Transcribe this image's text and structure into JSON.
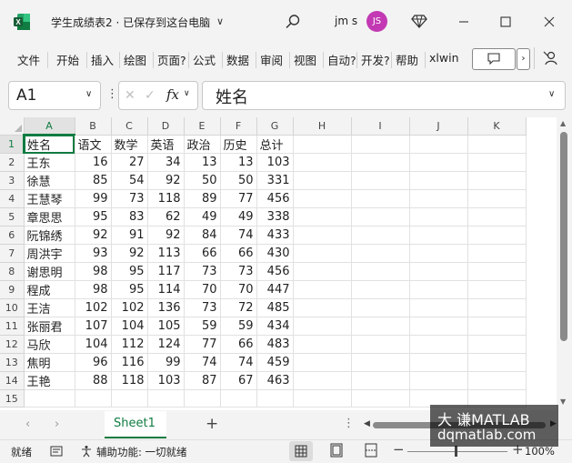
{
  "titlebar": {
    "doc_title": "学生成绩表2 · 已保存到这台电脑",
    "user_name": "jm s",
    "avatar_initials": "JS"
  },
  "ribbon": {
    "tabs": [
      "文件",
      "开始",
      "插入",
      "绘图",
      "页面?",
      "公式",
      "数据",
      "审阅",
      "视图",
      "自动?",
      "开发?",
      "帮助",
      "xlwin"
    ]
  },
  "formula_bar": {
    "name_box": "A1",
    "fx_label": "fx",
    "formula": "姓名"
  },
  "grid": {
    "columns": [
      "A",
      "B",
      "C",
      "D",
      "E",
      "F",
      "G",
      "H",
      "I",
      "J",
      "K"
    ],
    "selected_column": "A",
    "rows": [
      [
        "姓名",
        "语文",
        "数学",
        "英语",
        "政治",
        "历史",
        "总计"
      ],
      [
        "王东",
        "16",
        "27",
        "34",
        "13",
        "13",
        "103"
      ],
      [
        "徐慧",
        "85",
        "54",
        "92",
        "50",
        "50",
        "331"
      ],
      [
        "王慧琴",
        "99",
        "73",
        "118",
        "89",
        "77",
        "456"
      ],
      [
        "章思思",
        "95",
        "83",
        "62",
        "49",
        "49",
        "338"
      ],
      [
        "阮锦绣",
        "92",
        "91",
        "92",
        "84",
        "74",
        "433"
      ],
      [
        "周洪宇",
        "93",
        "92",
        "113",
        "66",
        "66",
        "430"
      ],
      [
        "谢思明",
        "98",
        "95",
        "117",
        "73",
        "73",
        "456"
      ],
      [
        "程成",
        "98",
        "95",
        "114",
        "70",
        "70",
        "447"
      ],
      [
        "王洁",
        "102",
        "102",
        "136",
        "73",
        "72",
        "485"
      ],
      [
        "张丽君",
        "107",
        "104",
        "105",
        "59",
        "59",
        "434"
      ],
      [
        "马欣",
        "104",
        "112",
        "124",
        "77",
        "66",
        "483"
      ],
      [
        "焦明",
        "96",
        "116",
        "99",
        "74",
        "74",
        "459"
      ],
      [
        "王艳",
        "88",
        "118",
        "103",
        "87",
        "67",
        "463"
      ],
      [
        "",
        "",
        "",
        "",
        "",
        "",
        ""
      ]
    ]
  },
  "sheets": {
    "active": "Sheet1"
  },
  "statusbar": {
    "ready": "就绪",
    "accessibility": "辅助功能: 一切就绪",
    "zoom": "100%"
  },
  "watermark": {
    "line1": "大 谦MATLAB",
    "line2": "dqmatlab.com"
  },
  "colors": {
    "excel_green": "#107c41",
    "avatar": "#c239b3"
  }
}
